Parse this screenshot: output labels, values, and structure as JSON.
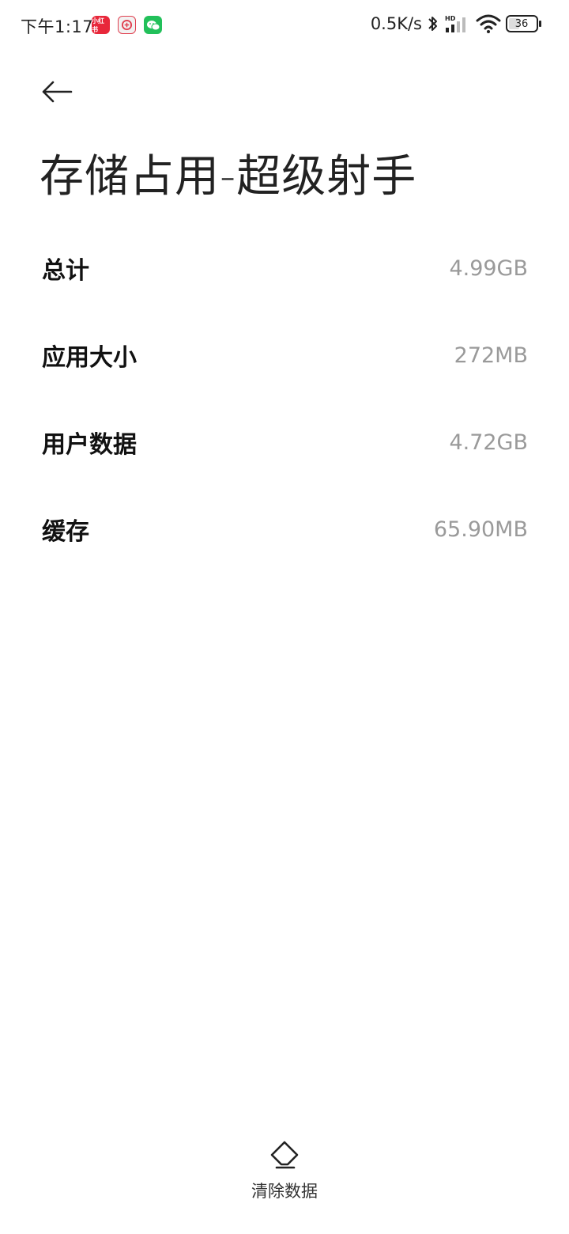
{
  "status_bar": {
    "time": "下午1:17",
    "net_speed": "0.5K/s",
    "signal_label": "HD",
    "battery_level": "36",
    "notifications": [
      {
        "icon": "xiaohongshu-icon",
        "label": "小红书",
        "color": "#e8273a"
      },
      {
        "icon": "app-badge-icon",
        "label": "",
        "color": "#e04050"
      },
      {
        "icon": "wechat-icon",
        "label": "",
        "color": "#22c05a"
      }
    ]
  },
  "header": {
    "back_icon": "arrow-left-icon",
    "title": "存储占用-超级射手"
  },
  "storage": {
    "rows": [
      {
        "label": "总计",
        "value": "4.99GB"
      },
      {
        "label": "应用大小",
        "value": "272MB"
      },
      {
        "label": "用户数据",
        "value": "4.72GB"
      },
      {
        "label": "缓存",
        "value": "65.90MB"
      }
    ]
  },
  "actions": {
    "clear_data_icon": "eraser-icon",
    "clear_data_label": "清除数据"
  }
}
